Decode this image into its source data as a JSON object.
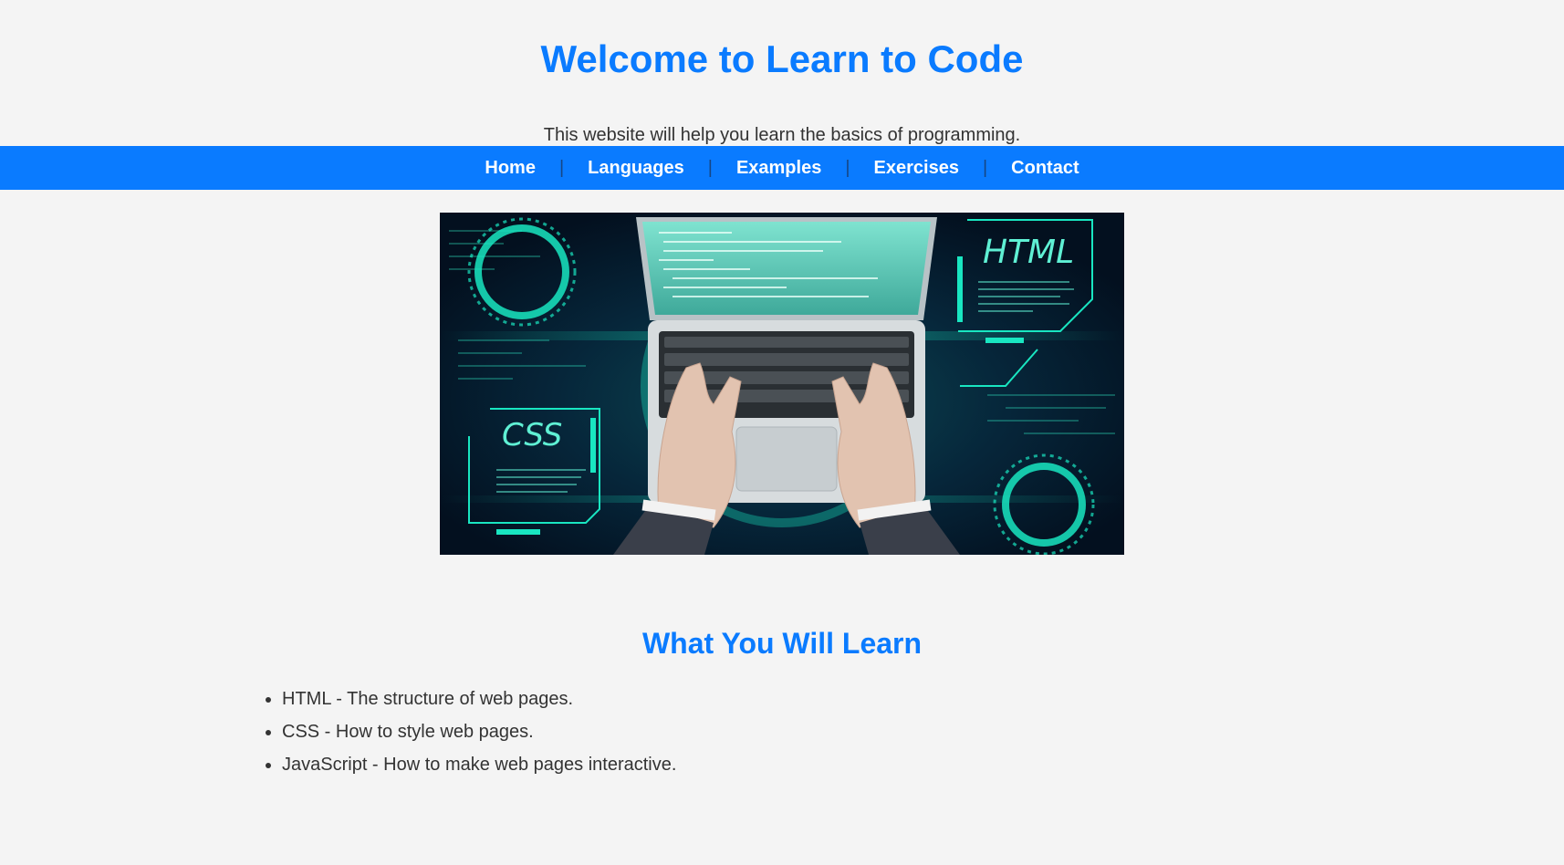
{
  "header": {
    "title": "Welcome to Learn to Code",
    "subtitle": "This website will help you learn the basics of programming."
  },
  "nav": {
    "items": [
      "Home",
      "Languages",
      "Examples",
      "Exercises",
      "Contact"
    ],
    "separator": "|"
  },
  "hero": {
    "labels": {
      "html": "HTML",
      "css": "CSS"
    }
  },
  "learn": {
    "title": "What You Will Learn",
    "items": [
      "HTML - The structure of web pages.",
      "CSS - How to style web pages.",
      "JavaScript - How to make web pages interactive."
    ]
  },
  "colors": {
    "accent": "#0a7bff",
    "background": "#f4f4f4",
    "text": "#333333",
    "hero_dark": "#04162b",
    "hero_glow": "#19e6c1"
  }
}
